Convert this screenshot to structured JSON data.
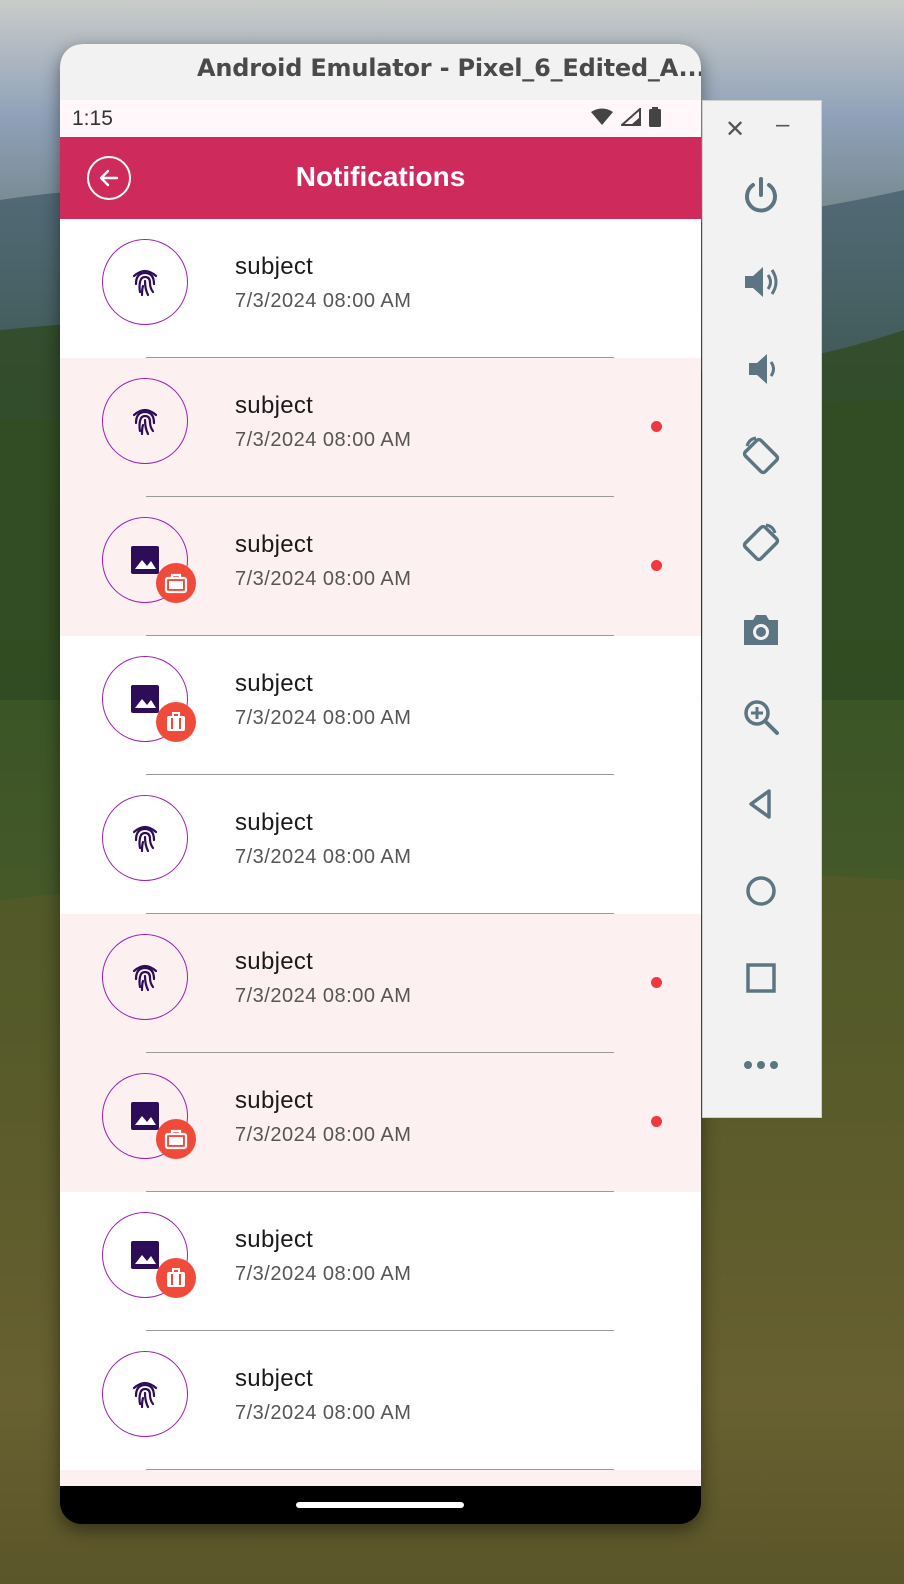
{
  "emulator": {
    "title": "Android Emulator - Pixel_6_Edited_A..."
  },
  "status_bar": {
    "time": "1:15",
    "icons": [
      "wifi-icon",
      "signal-icon",
      "battery-icon"
    ]
  },
  "app_bar": {
    "title": "Notifications",
    "back_icon": "arrow-back-circle-icon",
    "color": "#cf2a5c"
  },
  "notifications": [
    {
      "subject": "subject",
      "date": "7/3/2024 08:00 AM",
      "icon": "fingerprint-icon",
      "unread": false,
      "badge": null
    },
    {
      "subject": "subject",
      "date": "7/3/2024 08:00 AM",
      "icon": "fingerprint-icon",
      "unread": true,
      "badge": null
    },
    {
      "subject": "subject",
      "date": "7/3/2024 08:00 AM",
      "icon": "image-icon",
      "unread": true,
      "badge": "work-bag-icon"
    },
    {
      "subject": "subject",
      "date": "7/3/2024 08:00 AM",
      "icon": "image-icon",
      "unread": false,
      "badge": "luggage-icon"
    },
    {
      "subject": "subject",
      "date": "7/3/2024 08:00 AM",
      "icon": "fingerprint-icon",
      "unread": false,
      "badge": null
    },
    {
      "subject": "subject",
      "date": "7/3/2024 08:00 AM",
      "icon": "fingerprint-icon",
      "unread": true,
      "badge": null
    },
    {
      "subject": "subject",
      "date": "7/3/2024 08:00 AM",
      "icon": "image-icon",
      "unread": true,
      "badge": "work-bag-icon"
    },
    {
      "subject": "subject",
      "date": "7/3/2024 08:00 AM",
      "icon": "image-icon",
      "unread": false,
      "badge": "luggage-icon"
    },
    {
      "subject": "subject",
      "date": "7/3/2024 08:00 AM",
      "icon": "fingerprint-icon",
      "unread": false,
      "badge": null
    }
  ],
  "sidebar": {
    "buttons": [
      "close-icon",
      "minimize-icon",
      "power-icon",
      "volume-up-icon",
      "volume-down-icon",
      "rotate-left-icon",
      "rotate-right-icon",
      "camera-icon",
      "zoom-icon",
      "back-icon",
      "home-icon",
      "overview-icon",
      "more-icon"
    ]
  },
  "colors": {
    "unread_background": "#fdf0f1",
    "unread_dot": "#f1373f",
    "badge": "#f04a3a",
    "avatar_border": "#9b1fb0"
  }
}
